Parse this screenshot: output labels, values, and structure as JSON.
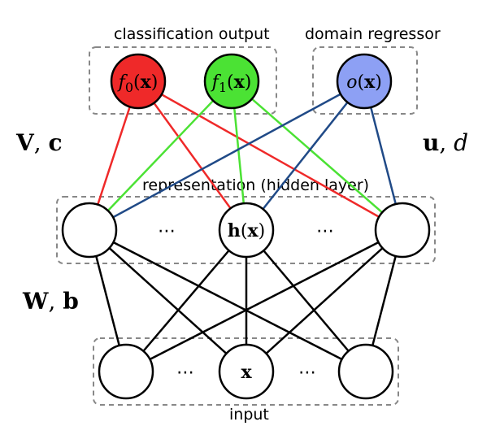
{
  "boxes": {
    "classification": "classification output",
    "domain": "domain regressor",
    "hidden": "representation (hidden layer)",
    "input": "input"
  },
  "nodes": {
    "f0_pre": "f",
    "f0_sub": "0",
    "f0_arg": "(",
    "f0_x": "x",
    "f0_close": ")",
    "f1_pre": "f",
    "f1_sub": "1",
    "f1_arg": "(",
    "f1_x": "x",
    "f1_close": ")",
    "o_pre": "o",
    "o_arg": "(",
    "o_x": "x",
    "o_close": ")",
    "h_pre": "h",
    "h_arg": "(",
    "h_x": "x",
    "h_close": ")",
    "x": "x"
  },
  "params": {
    "V": "V",
    "c": "c",
    "u": "u",
    "d": "d",
    "W": "W",
    "b": "b",
    "comma": ", "
  },
  "dots": "⋯",
  "chart_data": {
    "type": "diagram",
    "description": "Neural network architecture with input layer, hidden representation layer, classification output heads and a domain regressor head.",
    "layers": [
      {
        "name": "input",
        "label": "input",
        "symbol": "x",
        "visible_nodes": 3,
        "ellipsis": true
      },
      {
        "name": "hidden",
        "label": "representation (hidden layer)",
        "symbol": "h(x)",
        "visible_nodes": 3,
        "ellipsis": true,
        "params_from_input": [
          "W",
          "b"
        ]
      }
    ],
    "outputs": {
      "classification": {
        "label": "classification output",
        "nodes": [
          {
            "name": "f0",
            "symbol": "f_0(x)",
            "color": "#ef2929"
          },
          {
            "name": "f1",
            "symbol": "f_1(x)",
            "color": "#4be234"
          }
        ],
        "params_from_hidden": [
          "V",
          "c"
        ]
      },
      "domain_regressor": {
        "label": "domain regressor",
        "nodes": [
          {
            "name": "o",
            "symbol": "o(x)",
            "color": "#8da0f4"
          }
        ],
        "params_from_hidden": [
          "u",
          "d"
        ]
      }
    },
    "connections": [
      {
        "from_layer": "input",
        "to_layer": "hidden",
        "type": "dense",
        "color": "#000000"
      },
      {
        "from_layer": "hidden",
        "to_node": "f0",
        "type": "dense",
        "color": "#ef2929"
      },
      {
        "from_layer": "hidden",
        "to_node": "f1",
        "type": "dense",
        "color": "#4be234"
      },
      {
        "from_layer": "hidden",
        "to_node": "o",
        "type": "dense",
        "color": "#204a87"
      }
    ]
  }
}
